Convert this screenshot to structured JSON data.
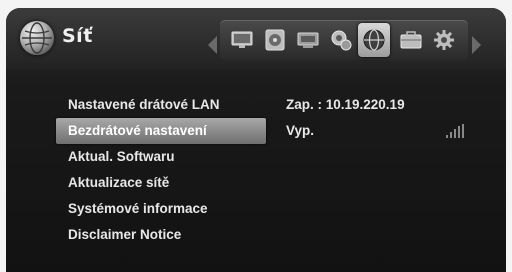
{
  "header": {
    "title": "Síť",
    "icons": [
      {
        "name": "tv-icon"
      },
      {
        "name": "disc-icon"
      },
      {
        "name": "display-icon"
      },
      {
        "name": "audio-icon"
      },
      {
        "name": "network-globe-icon",
        "selected": true
      },
      {
        "name": "briefcase-icon"
      },
      {
        "name": "settings-gear-icon"
      }
    ]
  },
  "menu": {
    "items": [
      {
        "label": "Nastavené drátové LAN"
      },
      {
        "label": "Bezdrátové nastavení",
        "active": true
      },
      {
        "label": "Aktual. Softwaru"
      },
      {
        "label": "Aktualizace sítě"
      },
      {
        "label": "Systémové informace"
      },
      {
        "label": "Disclaimer Notice"
      }
    ]
  },
  "values": {
    "wired": "Zap. : 10.19.220.19",
    "wireless": "Vyp."
  },
  "colors": {
    "background": "#121212",
    "highlight": "#a8a8a8",
    "text": "#e8e8e8"
  }
}
